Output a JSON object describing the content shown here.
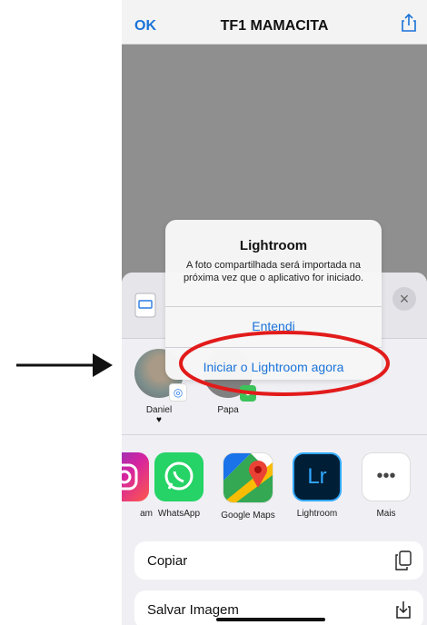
{
  "nav": {
    "ok_label": "OK",
    "title": "TF1 MAMACITA",
    "share_icon": "share-icon"
  },
  "contacts": [
    {
      "name": "Daniel",
      "extra": "♥",
      "badge": "airdrop"
    },
    {
      "name": "Papa",
      "extra": "",
      "badge": "messages"
    }
  ],
  "apps": [
    {
      "label": "am",
      "icon": "instagram-icon"
    },
    {
      "label": "WhatsApp",
      "icon": "whatsapp-icon"
    },
    {
      "label": "Google Maps",
      "icon": "google-maps-icon"
    },
    {
      "label": "Lightroom",
      "icon": "lightroom-icon"
    },
    {
      "label": "Mais",
      "icon": "more-icon"
    }
  ],
  "actions": [
    {
      "label": "Copiar",
      "icon": "copy-icon"
    },
    {
      "label": "Salvar Imagem",
      "icon": "save-icon"
    }
  ],
  "alert": {
    "title": "Lightroom",
    "message": "A foto compartilhada será importada na próxima vez que o aplicativo for iniciado.",
    "button_ok": "Entendi",
    "button_launch": "Iniciar o Lightroom agora"
  },
  "app_icons": {
    "lightroom_text": "Lr",
    "more_glyph": "•••"
  },
  "colors": {
    "accent": "#1a73d9",
    "annotation_red": "#e21b1b",
    "arrow": "#111111"
  }
}
